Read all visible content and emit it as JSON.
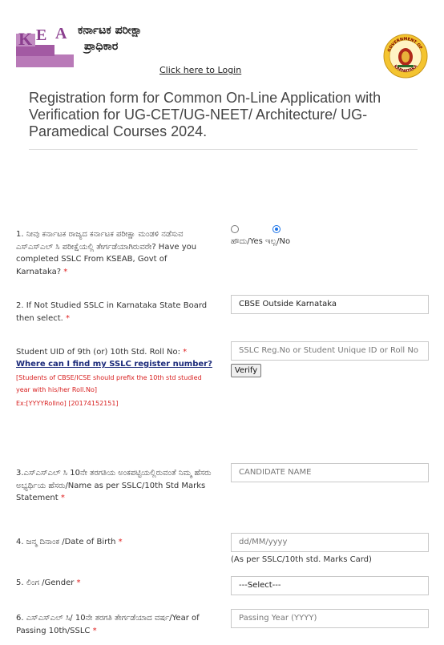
{
  "header": {
    "logo_letters": [
      "K",
      "E",
      "A"
    ],
    "org_name_line1": "ಕರ್ನಾಟಕ ಪರೀಕ್ಷಾ",
    "org_name_line2": "ಪ್ರಾಧಿಕಾರ",
    "login_link": "Click here to Login",
    "emblem_text_top": "GOVERNMENT OF",
    "emblem_text_bottom": "KARNATAKA"
  },
  "form": {
    "title": "Registration form for Common On-Line Application with Verification for UG-CET/UG-NEET/ Architecture/ UG-Paramedical Courses 2024.",
    "q1": {
      "label": "1. ನೀವು ಕರ್ನಾಟಕ ರಾಜ್ಯದ ಕರ್ನಾಟಕ ಪರೀಕ್ಷಾ ಮಂಡಳಿ ನಡೆಸುವ ಎಸ್‌ಎಸ್‌ಎಲ್ ಸಿ ಪರೀಕ್ಷೆಯಲ್ಲಿ ತೇರ್ಗಡೆಯಾಗಿರುವರೇ? Have you completed SSLC From KSEAB, Govt of Karnataka?",
      "req": "*",
      "options": "ಹೌದು/Yes ಇಲ್ಲ/No",
      "selected": "No"
    },
    "q2": {
      "label": "2. If Not Studied SSLC in Karnataka State Board then select.",
      "req": "*",
      "value": "CBSE Outside Karnataka"
    },
    "q_uid": {
      "label": "Student UID of 9th (or) 10th Std. Roll No:",
      "req": "*",
      "find_link": "Where can I find my SSLC register number?",
      "note": "[Students of CBSE/ICSE should prefix the 10th std studied year with his/her Roll.No]",
      "example": "Ex:[YYYYRollno] [20174152151]",
      "placeholder": "SSLC Reg.No or Student Unique ID or Roll No",
      "verify_label": "Verify"
    },
    "q3": {
      "label": "3.ಎಸ್‌ಎಸ್‌ಎಲ್ ಸಿ 10ನೇ ತರಗತಿಯ ಅಂಕಪಟ್ಟಿಯಲ್ಲಿರುವಂತೆ ನಿಮ್ಮ ಹೆಸರು ಅಭ್ಯರ್ಥಿಯ ಹೆಸರು/Name as per SSLC/10th Std Marks Statement",
      "req": "*",
      "placeholder": "CANDIDATE NAME"
    },
    "q4": {
      "label": "4. ಜನ್ಮ ದಿನಾಂಕ /Date of Birth",
      "req": "*",
      "placeholder": "dd/MM/yyyy",
      "hint": "(As per SSLC/10th std. Marks Card)"
    },
    "q5": {
      "label": "5. ಲಿಂಗ /Gender",
      "req": "*",
      "value": "---Select---"
    },
    "q6": {
      "label": "6. ಎಸ್‌ಎಸ್‌ಎಲ್ ಸಿ/ 10ನೇ ತರಗತಿ ತೇರ್ಗಡೆಯಾದ ವರ್ಷ/Year of Passing 10th/SSLC",
      "req": "*",
      "placeholder": "Passing Year (YYYY)"
    }
  },
  "colors": {
    "logo_purple": "#8b3f8f",
    "logo_light": "#b97ab8",
    "required": "#e02020",
    "note_red": "#d82020",
    "link_blue": "#1b2a7a",
    "radio_blue": "#1a73e8"
  }
}
